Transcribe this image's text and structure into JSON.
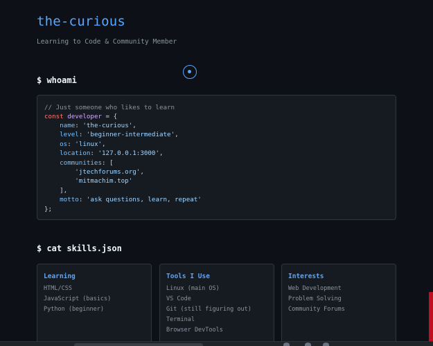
{
  "header": {
    "title": "the-curious",
    "subtitle": "Learning to Code & Community Member"
  },
  "sections": {
    "whoami_heading": "$ whoami",
    "skills_heading": "$ cat skills.json"
  },
  "code": {
    "comment": "// Just someone who likes to learn",
    "kw_const": "const",
    "var_name": "developer",
    "eq_open": " = {",
    "name_key": "name",
    "name_val": "'the-curious'",
    "level_key": "level",
    "level_val": "'beginner-intermediate'",
    "os_key": "os",
    "os_val": "'linux'",
    "location_key": "location",
    "location_val": "'127.0.0.1:3000'",
    "communities_key": "communities",
    "communities_open": ": [",
    "community_1": "'jtechforums.org'",
    "community_2": "'mitmachim.top'",
    "communities_close": "],",
    "motto_key": "motto",
    "motto_val": "'ask questions, learn, repeat'",
    "close": "};"
  },
  "cards": {
    "learning": {
      "title": "Learning",
      "items": [
        "HTML/CSS",
        "JavaScript (basics)",
        "Python (beginner)"
      ]
    },
    "tools": {
      "title": "Tools I Use",
      "items": [
        "Linux (main OS)",
        "VS Code",
        "Git (still figuring out)",
        "Terminal",
        "Browser DevTools"
      ]
    },
    "interests": {
      "title": "Interests",
      "items": [
        "Web Development",
        "Problem Solving",
        "Community Forums"
      ]
    }
  },
  "colors": {
    "background": "#0d1117",
    "accent": "#58a6ff",
    "panel": "#161b22",
    "border": "#30363d"
  },
  "icons": {
    "cursor": "cursor-ring-icon"
  }
}
